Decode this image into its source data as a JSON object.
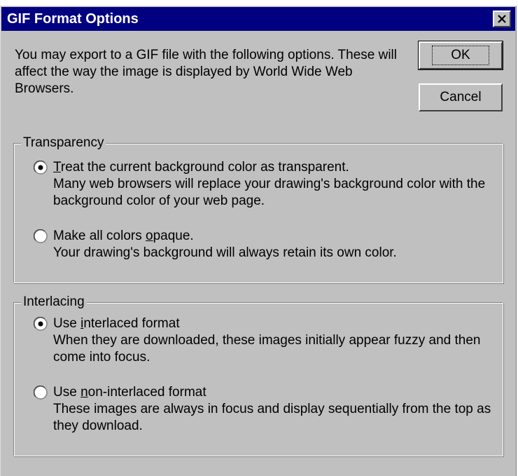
{
  "dialog": {
    "title": "GIF Format Options",
    "intro": "You may export to a GIF file with the following options. These will affect the way the image is displayed by World Wide Web Browsers.",
    "ok_label": "OK",
    "cancel_label": "Cancel"
  },
  "transparency": {
    "legend": "Transparency",
    "options": [
      {
        "mnemonic": "T",
        "label_rest": "reat the current background color as transparent.",
        "label_full": "Treat the current background color as transparent.",
        "description": "Many web browsers will replace your drawing's background color with the background color of your web page.",
        "selected": true
      },
      {
        "label_pre": "Make all colors ",
        "mnemonic": "o",
        "label_rest": "paque.",
        "label_full": "Make all colors opaque.",
        "description": "Your drawing's background will always retain its own color.",
        "selected": false
      }
    ]
  },
  "interlacing": {
    "legend": "Interlacing",
    "options": [
      {
        "label_pre": "Use ",
        "mnemonic": "i",
        "label_rest": "nterlaced format",
        "label_full": "Use interlaced format",
        "description": "When they are downloaded, these images initially appear fuzzy and then come into focus.",
        "selected": true
      },
      {
        "label_pre": "Use ",
        "mnemonic": "n",
        "label_rest": "on-interlaced format",
        "label_full": "Use non-interlaced format",
        "description": "These images are always in focus and display sequentially from the top as they download.",
        "selected": false
      }
    ]
  },
  "icons": {
    "close": "close-icon",
    "radio_on": "radio-selected-icon",
    "radio_off": "radio-unselected-icon"
  }
}
